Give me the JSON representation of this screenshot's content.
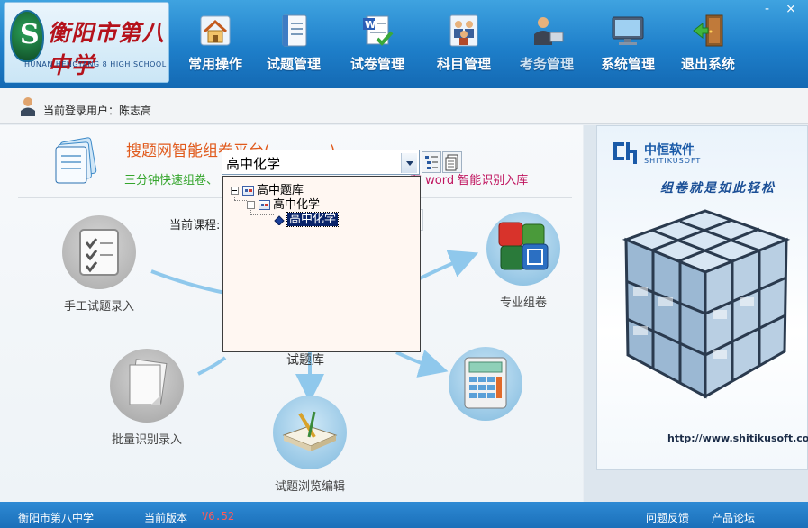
{
  "window": {
    "minimize": "-",
    "close": "×"
  },
  "header": {
    "logo_title": "衡阳市第八中学",
    "logo_sub": "HUNAN HENGYANG 8 HIGH SCHOOL"
  },
  "menu": [
    {
      "label": "常用操作",
      "icon": "house-icon"
    },
    {
      "label": "试题管理",
      "icon": "notebook-icon"
    },
    {
      "label": "试卷管理",
      "icon": "word-doc-check-icon"
    },
    {
      "label": "科目管理",
      "icon": "people-group-icon"
    },
    {
      "label": "考务管理",
      "icon": "presenter-icon"
    },
    {
      "label": "系统管理",
      "icon": "monitor-icon"
    },
    {
      "label": "退出系统",
      "icon": "exit-door-icon"
    }
  ],
  "user": {
    "label": "当前登录用户：陈志高"
  },
  "platform": {
    "title_prefix": "搜题网智能组卷平台(",
    "title_suffix": ")",
    "slogan_left": "三分钟快速组卷、",
    "slogan_right": "有 word 智能识别入库",
    "current_course_label": "当前课程:"
  },
  "workflow": {
    "manual": "手工试题录入",
    "batch": "批量识别录入",
    "browse": "试题浏览编辑",
    "professional": "专业组卷",
    "bank": "试题库"
  },
  "course_combo": {
    "value": "高中化学"
  },
  "tree": {
    "root": "高中题库",
    "child": "高中化学",
    "leaf": "高中化学"
  },
  "promo": {
    "brand": "中恒软件",
    "brand_sub": "SHITIKUSOFT",
    "slogan": "组卷就是如此轻松",
    "url": "http://www.shitikusoft.com"
  },
  "status": {
    "school": "衡阳市第八中学",
    "version_label": "当前版本",
    "version": "V6.52",
    "feedback": "问题反馈",
    "forum": "产品论坛"
  },
  "colors": {
    "banner": "#1e7fca",
    "title_orange": "#e05a1c",
    "slogan_green": "#34a52b",
    "slogan_magenta": "#c0145e",
    "selection": "#0a246a",
    "version_red": "#ff5a5a"
  }
}
